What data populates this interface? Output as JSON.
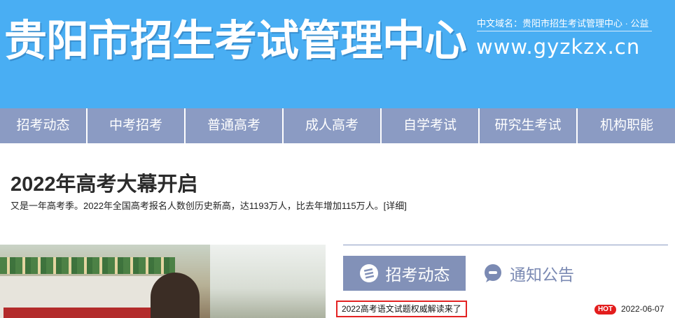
{
  "banner": {
    "title": "贵阳市招生考试管理中心",
    "domain_cn": "中文域名：贵阳市招生考试管理中心 · 公益",
    "domain_en": "www.gyzkzx.cn"
  },
  "nav": {
    "items": [
      {
        "label": "招考动态"
      },
      {
        "label": "中考招考"
      },
      {
        "label": "普通高考"
      },
      {
        "label": "成人高考"
      },
      {
        "label": "自学考试"
      },
      {
        "label": "研究生考试"
      },
      {
        "label": "机构职能"
      }
    ]
  },
  "headline": {
    "title": "2022年高考大幕开启",
    "summary": "又是一年高考季。2022年全国高考报名人数创历史新高，达1193万人，比去年增加115万人。",
    "detail_link": "[详细]"
  },
  "photo": {
    "icon": "photo-image"
  },
  "tabs": {
    "active": {
      "label": "招考动态",
      "icon": "news-icon"
    },
    "inactive": {
      "label": "通知公告",
      "icon": "chat-bubble-icon"
    }
  },
  "news": {
    "items": [
      {
        "title": "2022高考语文试题权威解读来了",
        "badge": "HOT",
        "date": "2022-06-07"
      }
    ]
  },
  "colors": {
    "banner": "#49aef3",
    "nav": "#8b9bc3",
    "tab_active": "#8291b8",
    "hot_badge": "#e31d1d",
    "highlight_border": "#e32222"
  }
}
